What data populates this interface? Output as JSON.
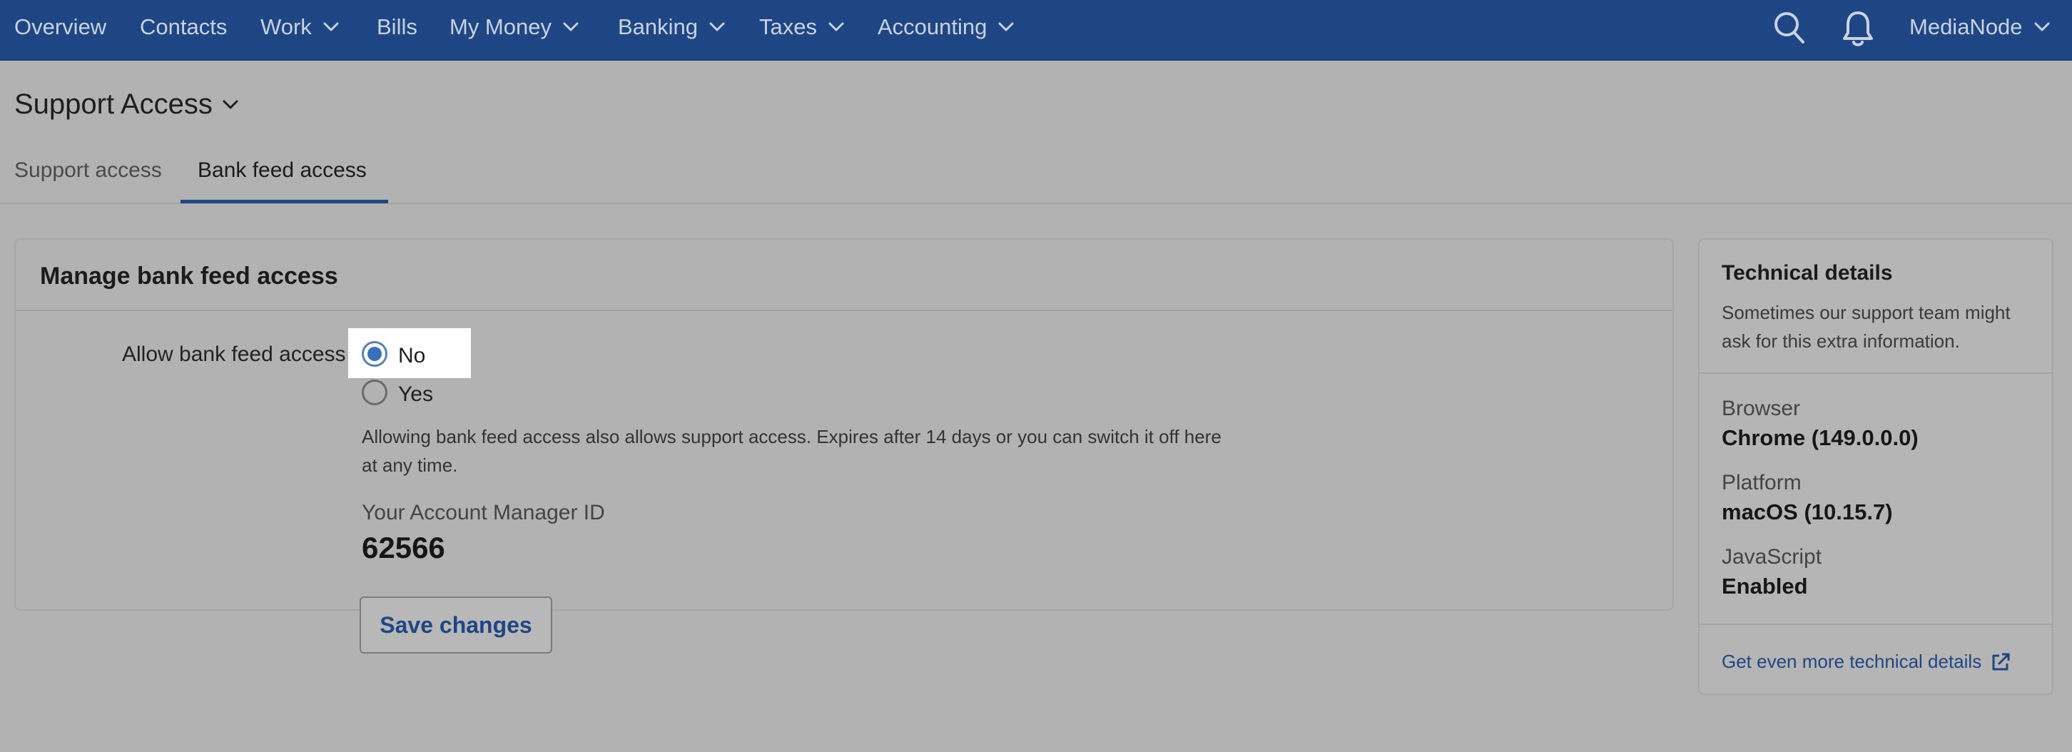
{
  "nav": {
    "items": [
      {
        "label": "Overview",
        "has_dropdown": false
      },
      {
        "label": "Contacts",
        "has_dropdown": false
      },
      {
        "label": "Work",
        "has_dropdown": true
      },
      {
        "label": "Bills",
        "has_dropdown": false
      },
      {
        "label": "My Money",
        "has_dropdown": true
      },
      {
        "label": "Banking",
        "has_dropdown": true
      },
      {
        "label": "Taxes",
        "has_dropdown": true
      },
      {
        "label": "Accounting",
        "has_dropdown": true
      }
    ],
    "search_icon": "search-icon",
    "notifications_icon": "bell-icon",
    "account_label": "MediaNode"
  },
  "page": {
    "title": "Support Access",
    "tabs": [
      {
        "label": "Support access",
        "active": false
      },
      {
        "label": "Bank feed access",
        "active": true
      }
    ]
  },
  "card": {
    "title": "Manage bank feed access",
    "field_label": "Allow bank feed access",
    "options": [
      {
        "label": "No",
        "checked": true
      },
      {
        "label": "Yes",
        "checked": false
      }
    ],
    "helper_text": "Allowing bank feed access also allows support access. Expires after 14 days or you can switch it off here at any time.",
    "account_manager_label": "Your Account Manager ID",
    "account_manager_id": "62566"
  },
  "save_button_label": "Save changes",
  "technical": {
    "title": "Technical details",
    "description": "Sometimes our support team might ask for this extra information.",
    "details": [
      {
        "label": "Browser",
        "value": "Chrome (149.0.0.0)"
      },
      {
        "label": "Platform",
        "value": "macOS (10.15.7)"
      },
      {
        "label": "JavaScript",
        "value": "Enabled"
      }
    ],
    "more_link": "Get even more technical details"
  },
  "colors": {
    "nav_bg": "#1f4684",
    "accent": "#1f4684",
    "radio_selected": "#3a6fc0",
    "page_bg": "#b2b2b2"
  }
}
